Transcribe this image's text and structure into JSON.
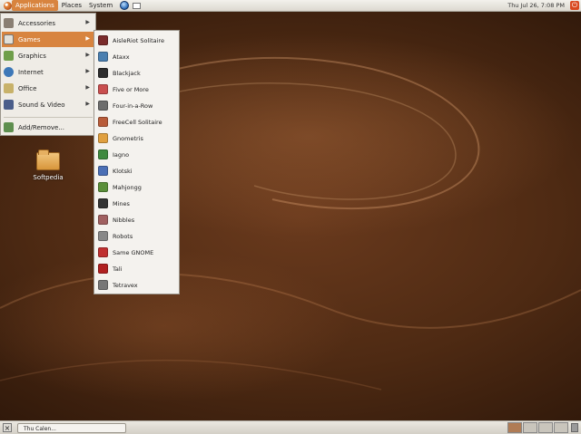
{
  "top_panel": {
    "menus": [
      "Applications",
      "Places",
      "System"
    ],
    "tray_clock": "Thu Jul 26,  7:08 PM"
  },
  "app_menu": {
    "items": [
      {
        "label": "Accessories",
        "has_submenu": true,
        "active": false
      },
      {
        "label": "Games",
        "has_submenu": true,
        "active": true
      },
      {
        "label": "Graphics",
        "has_submenu": true,
        "active": false
      },
      {
        "label": "Internet",
        "has_submenu": true,
        "active": false
      },
      {
        "label": "Office",
        "has_submenu": true,
        "active": false
      },
      {
        "label": "Sound & Video",
        "has_submenu": true,
        "active": false
      }
    ],
    "footer_item": "Add/Remove..."
  },
  "games_menu": {
    "items": [
      {
        "label": "AisleRiot Solitaire",
        "color": "#7a2b2b"
      },
      {
        "label": "Ataxx",
        "color": "#4a7fb0"
      },
      {
        "label": "Blackjack",
        "color": "#2d2d2d"
      },
      {
        "label": "Five or More",
        "color": "#c94f4f"
      },
      {
        "label": "Four-in-a-Row",
        "color": "#6d6d6d"
      },
      {
        "label": "FreeCell Solitaire",
        "color": "#b85c3a"
      },
      {
        "label": "Gnometris",
        "color": "#e0a040"
      },
      {
        "label": "Iagno",
        "color": "#3f8a3f"
      },
      {
        "label": "Klotski",
        "color": "#4b6fb5"
      },
      {
        "label": "Mahjongg",
        "color": "#5a8f3a"
      },
      {
        "label": "Mines",
        "color": "#333333"
      },
      {
        "label": "Nibbles",
        "color": "#a06060"
      },
      {
        "label": "Robots",
        "color": "#888888"
      },
      {
        "label": "Same GNOME",
        "color": "#c03030"
      },
      {
        "label": "Tali",
        "color": "#b02020"
      },
      {
        "label": "Tetravex",
        "color": "#777777"
      }
    ]
  },
  "desktop": {
    "icon_label": "Softpedia"
  },
  "bottom_panel": {
    "task_label": "Thu Calen..."
  }
}
